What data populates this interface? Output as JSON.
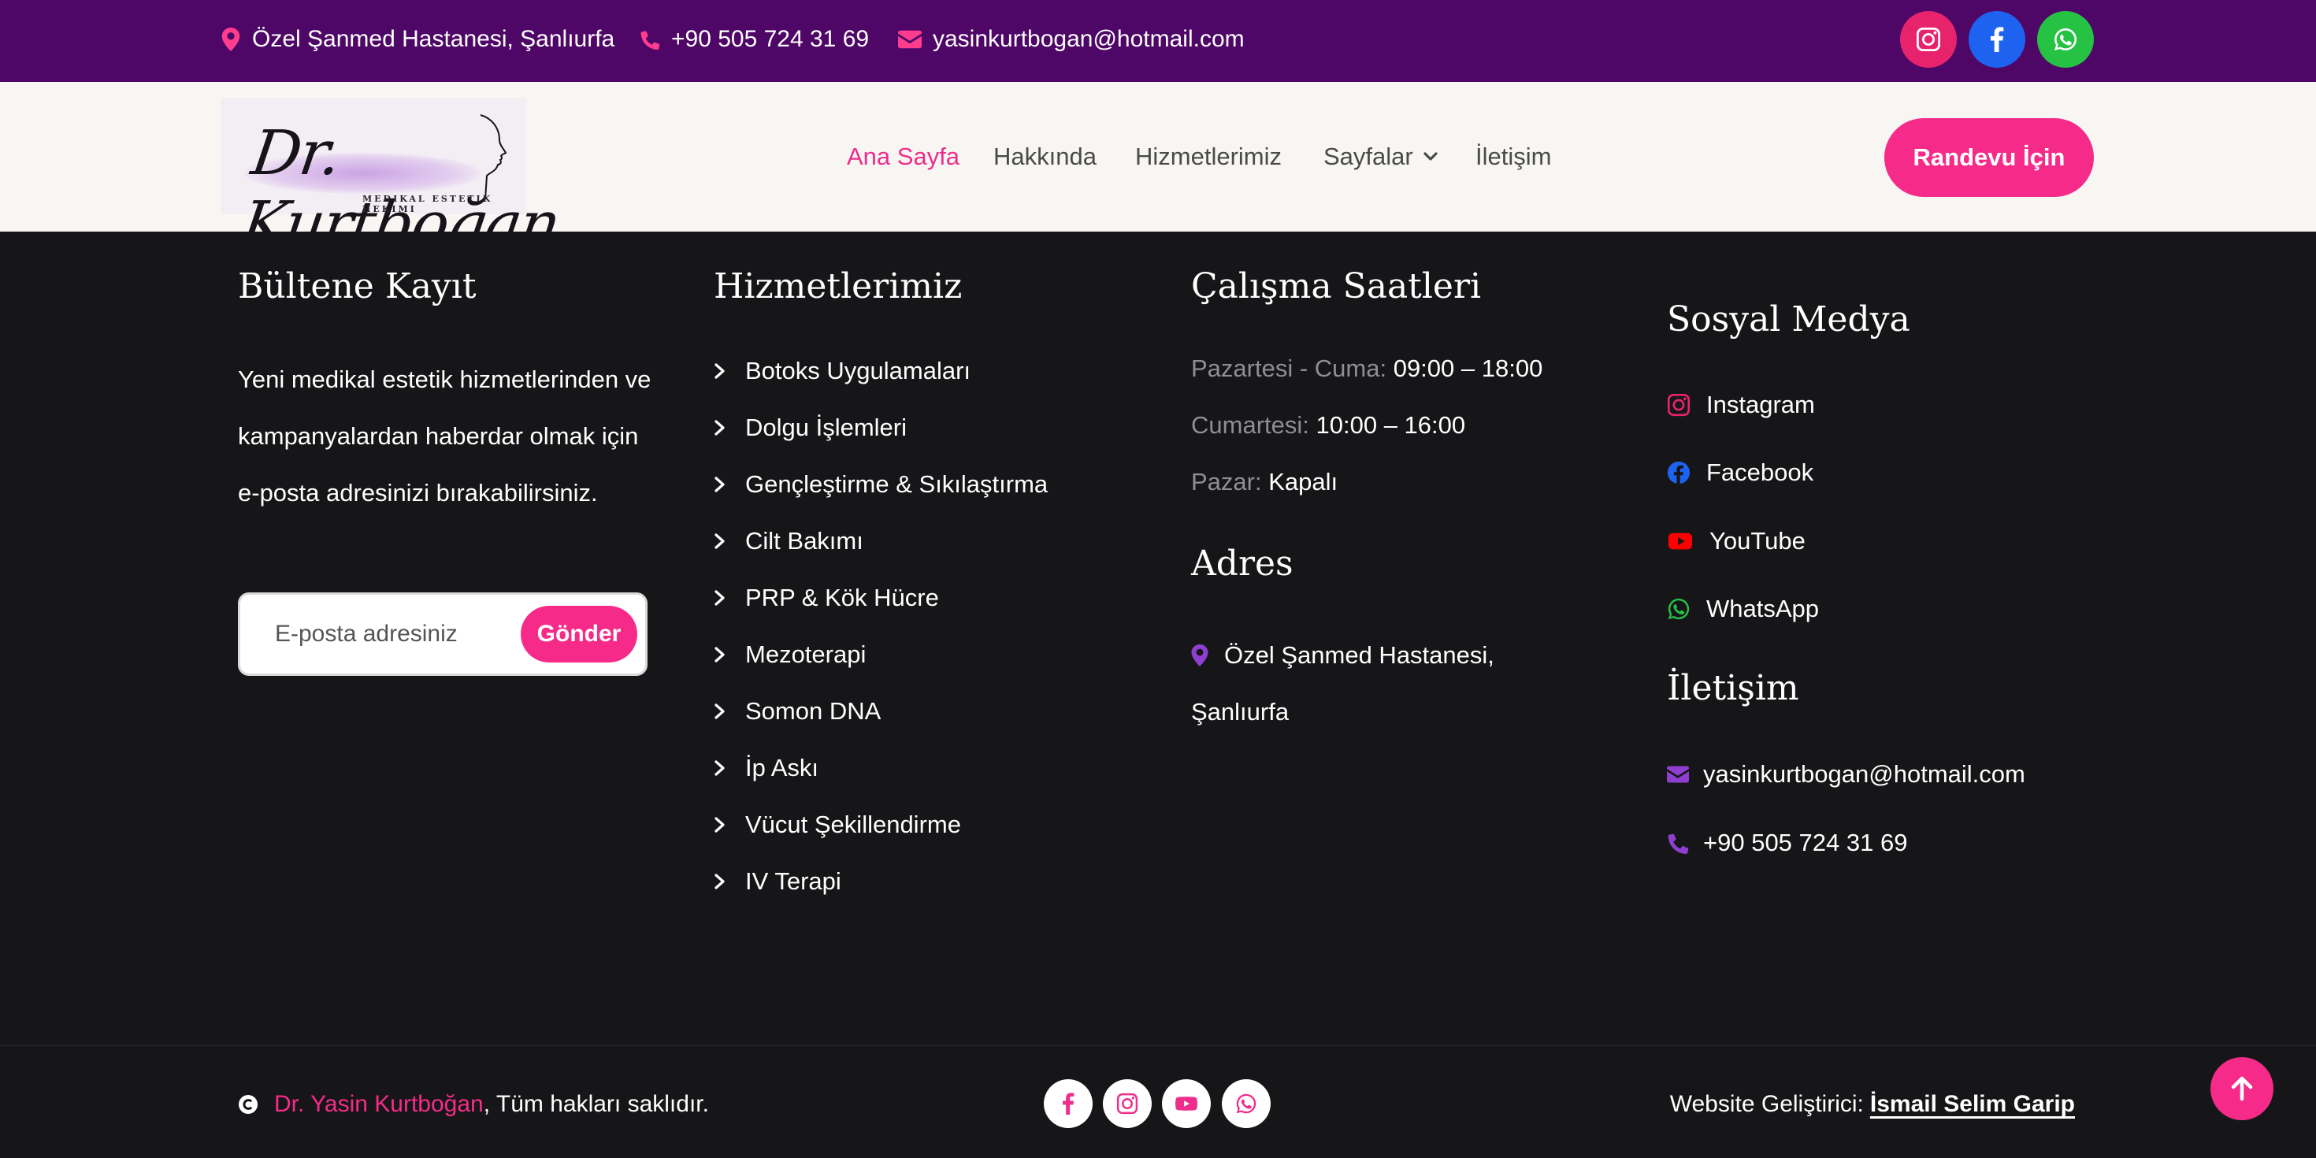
{
  "topbar": {
    "address": "Özel Şanmed Hastanesi, Şanlıurfa",
    "phone": "+90 505 724 31 69",
    "email": "yasinkurtbogan@hotmail.com",
    "social_icons": [
      "instagram-icon",
      "facebook-icon",
      "whatsapp-icon"
    ],
    "colors": {
      "background": "#4e0767",
      "icon_accent": "#ff3d8f",
      "instagram": "#e8236e",
      "facebook": "#1d63f0",
      "whatsapp": "#25c244"
    }
  },
  "header": {
    "logo": {
      "script": "Dr. Kurtboğan",
      "subtitle": "MEDIKAL ESTETIK HEKIMI"
    },
    "nav": [
      {
        "label": "Ana Sayfa",
        "active": true
      },
      {
        "label": "Hakkında"
      },
      {
        "label": "Hizmetlerimiz"
      },
      {
        "label": "Sayfalar",
        "dropdown": true
      },
      {
        "label": "İletişim"
      }
    ],
    "cta_label": "Randevu İçin",
    "colors": {
      "accent": "#f62b89",
      "background": "#f8f6f2"
    }
  },
  "newsletter": {
    "heading": "Bültene Kayıt",
    "text": "Yeni medikal estetik hizmetlerinden ve kampanyalardan haberdar olmak için e-posta adresinizi bırakabilirsiniz.",
    "placeholder": "E-posta adresiniz",
    "button_label": "Gönder"
  },
  "services": {
    "heading": "Hizmetlerimiz",
    "items": [
      "Botoks Uygulamaları",
      "Dolgu İşlemleri",
      "Gençleştirme & Sıkılaştırma",
      "Cilt Bakımı",
      "PRP & Kök Hücre",
      "Mezoterapi",
      "Somon DNA",
      "İp Askı",
      "Vücut Şekillendirme",
      "IV Terapi"
    ]
  },
  "hours": {
    "heading": "Çalışma Saatleri",
    "rows": [
      {
        "day": "Pazartesi - Cuma",
        "time": "09:00 – 18:00"
      },
      {
        "day": "Cumartesi",
        "time": "10:00 – 16:00"
      },
      {
        "day": "Pazar",
        "time": "Kapalı"
      }
    ]
  },
  "address": {
    "heading": "Adres",
    "text": "Özel Şanmed Hastanesi, Şanlıurfa"
  },
  "social": {
    "heading": "Sosyal Medya",
    "items": [
      {
        "label": "Instagram",
        "icon": "instagram-icon",
        "color": "#e8236e"
      },
      {
        "label": "Facebook",
        "icon": "facebook-icon",
        "color": "#1d63f0"
      },
      {
        "label": "YouTube",
        "icon": "youtube-icon",
        "color": "#ff0000"
      },
      {
        "label": "WhatsApp",
        "icon": "whatsapp-icon",
        "color": "#25c244"
      }
    ]
  },
  "contact": {
    "heading": "İletişim",
    "email": "yasinkurtbogan@hotmail.com",
    "phone": "+90 505 724 31 69"
  },
  "footer": {
    "owner": "Dr. Yasin Kurtboğan",
    "rights": ", Tüm hakları saklıdır.",
    "social_icons": [
      "facebook-icon",
      "instagram-icon",
      "youtube-icon",
      "whatsapp-icon"
    ],
    "developer_label": "Website Geliştirici:",
    "developer_name": "İsmail Selim Garip"
  }
}
